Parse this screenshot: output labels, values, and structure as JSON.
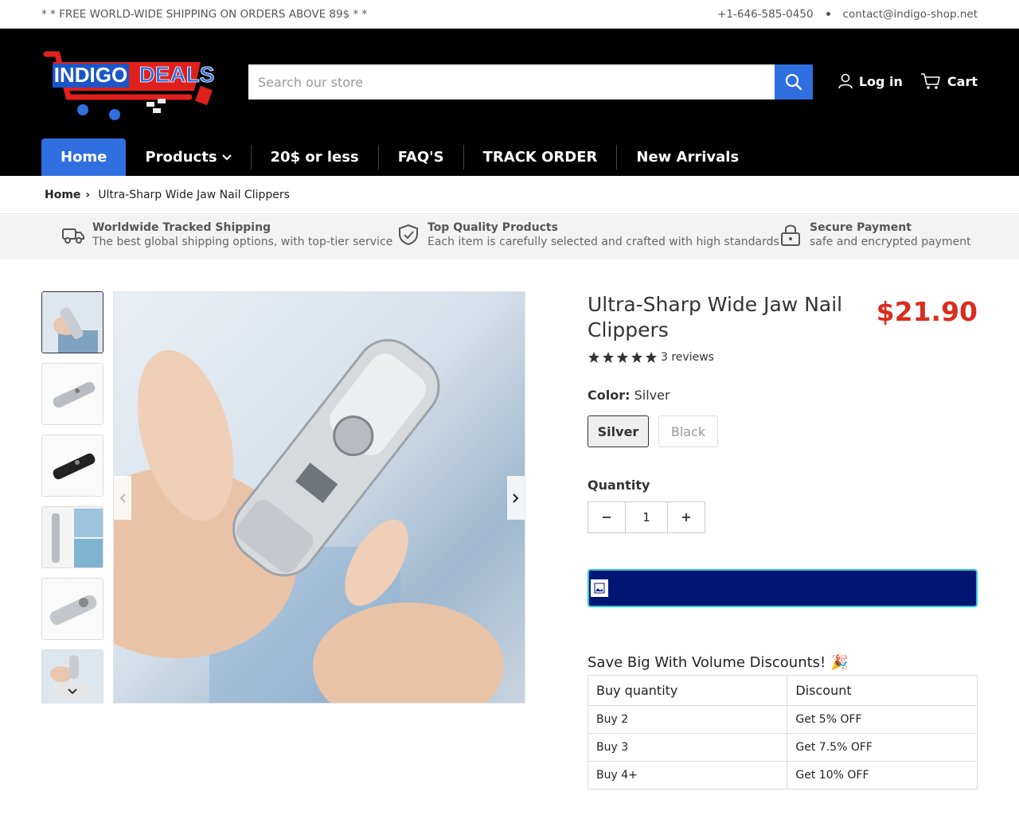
{
  "topbar": {
    "promo": "* * FREE WORLD-WIDE SHIPPING ON ORDERS ABOVE 89$ * *",
    "phone": "+1-646-585-0450",
    "email": "contact@indigo-shop.net"
  },
  "header": {
    "logo_text_1": "INDIGO",
    "logo_text_2": "DEALS",
    "search_placeholder": "Search our store",
    "login": "Log in",
    "cart": "Cart"
  },
  "nav": {
    "items": [
      "Home",
      "Products",
      "20$ or less",
      "FAQ'S",
      "TRACK ORDER",
      "New Arrivals"
    ]
  },
  "breadcrumb": {
    "home": "Home",
    "current": "Ultra-Sharp Wide Jaw Nail Clippers"
  },
  "features": [
    {
      "title": "Worldwide Tracked Shipping",
      "text": "The best global shipping options, with top-tier service",
      "icon": "truck-icon"
    },
    {
      "title": "Top Quality Products",
      "text": "Each item is carefully selected and crafted with high standards",
      "icon": "shield-check-icon"
    },
    {
      "title": "Secure Payment",
      "text": "safe and encrypted payment",
      "icon": "lock-icon"
    }
  ],
  "product": {
    "title": "Ultra-Sharp Wide Jaw Nail Clippers",
    "price": "$21.90",
    "rating": 5,
    "reviews": "3 reviews",
    "color_label": "Color:",
    "color_value": "Silver",
    "colors": [
      "Silver",
      "Black"
    ],
    "quantity_label": "Quantity",
    "quantity": "1",
    "accent": "#d92d1e"
  },
  "volume": {
    "title": "Save Big With Volume Discounts! 🎉",
    "headers": [
      "Buy quantity",
      "Discount"
    ],
    "rows": [
      [
        "Buy 2",
        "Get 5% OFF"
      ],
      [
        "Buy 3",
        "Get 7.5% OFF"
      ],
      [
        "Buy 4+",
        "Get 10% OFF"
      ]
    ]
  }
}
